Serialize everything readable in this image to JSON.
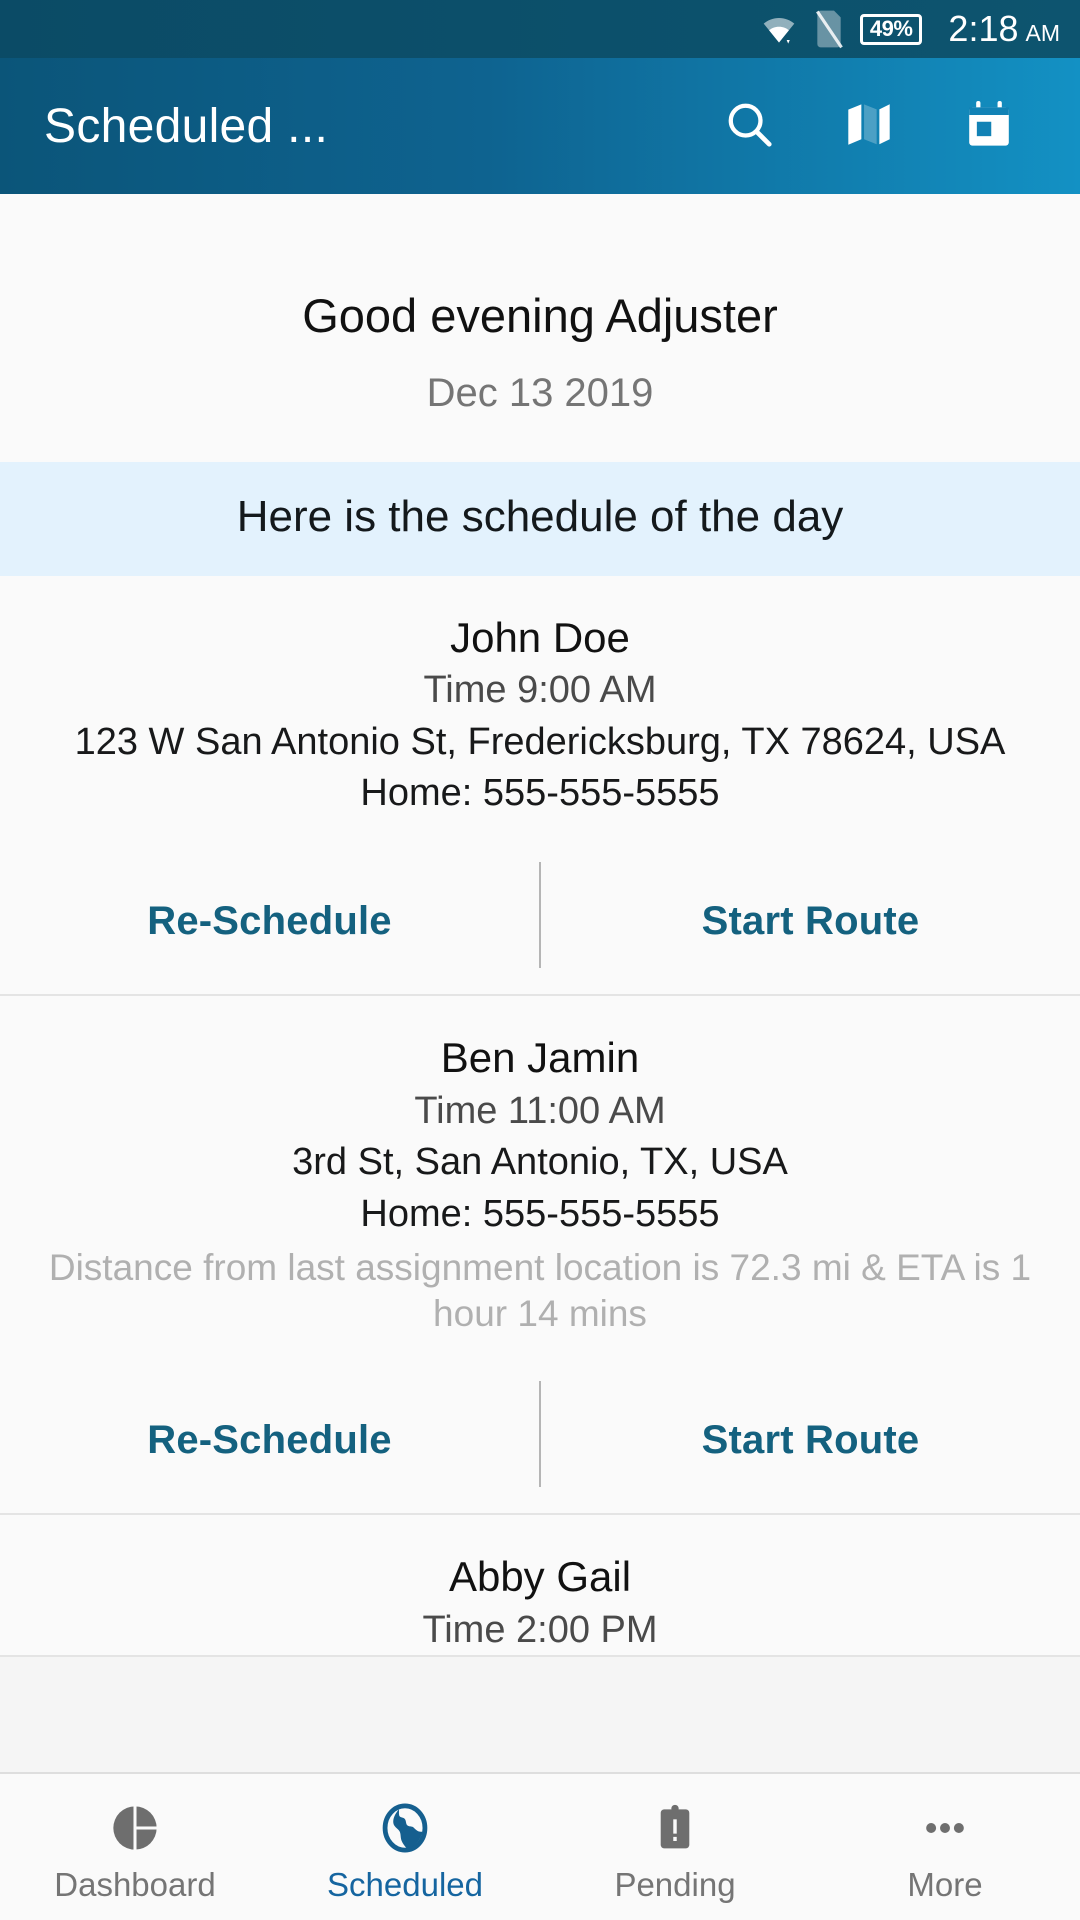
{
  "status_bar": {
    "wifi_icon": "wifi-icon",
    "sim_icon": "no-sim-icon",
    "battery_text": "49%",
    "time": "2:18",
    "meridiem": "AM"
  },
  "app_bar": {
    "title": "Scheduled ...",
    "actions": [
      {
        "name": "search-icon",
        "label": "Search"
      },
      {
        "name": "map-icon",
        "label": "Map"
      },
      {
        "name": "calendar-icon",
        "label": "Calendar"
      }
    ]
  },
  "greeting": {
    "title": "Good evening Adjuster",
    "date": "Dec 13 2019"
  },
  "banner": {
    "text": "Here is the schedule of the day"
  },
  "actions": {
    "reschedule_label": "Re-Schedule",
    "start_route_label": "Start Route"
  },
  "appointments": [
    {
      "name": "John Doe",
      "time": "Time 9:00 AM",
      "address": "123 W San Antonio St, Fredericksburg, TX 78624, USA",
      "phone": "Home: 555-555-5555",
      "distance": ""
    },
    {
      "name": "Ben Jamin",
      "time": "Time 11:00 AM",
      "address": "3rd St, San Antonio, TX, USA",
      "phone": "Home: 555-555-5555",
      "distance": "Distance from last assignment location is 72.3 mi & ETA is 1 hour 14 mins"
    },
    {
      "name": "Abby Gail",
      "time": "Time 2:00 PM",
      "address": "",
      "phone": "",
      "distance": ""
    }
  ],
  "bottom_nav": {
    "items": [
      {
        "label": "Dashboard",
        "icon": "pie-chart-icon",
        "active": false
      },
      {
        "label": "Scheduled",
        "icon": "globe-icon",
        "active": true
      },
      {
        "label": "Pending",
        "icon": "clipboard-alert-icon",
        "active": false
      },
      {
        "label": "More",
        "icon": "more-horizontal-icon",
        "active": false
      }
    ]
  },
  "colors": {
    "app_bar_start": "#0b5579",
    "app_bar_end": "#1391c4",
    "status_bar": "#0b4b66",
    "banner_bg": "#e3f2fd",
    "accent_link": "#14617f",
    "nav_active": "#1565a0",
    "nav_inactive": "#757575",
    "page_bg": "#fafafa"
  }
}
